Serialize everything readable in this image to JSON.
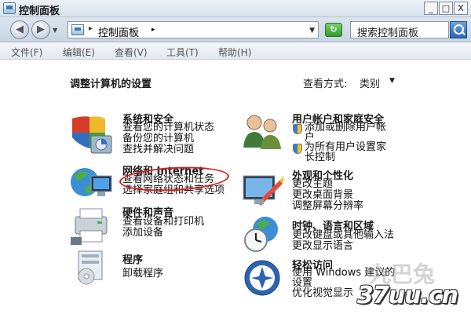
{
  "window": {
    "title": "控制面板",
    "minimize": "_",
    "maximize": "□",
    "close": "X"
  },
  "addressbar": {
    "separator": "▸",
    "path": "控制面板",
    "path_caret": "▸",
    "dropdown": "▼",
    "search_placeholder": "搜索控制面板",
    "back": "◀",
    "forward": "▶",
    "nav_dropdown": "▼",
    "refresh": "↻"
  },
  "menu": [
    "文件(F)",
    "编辑(E)",
    "查看(V)",
    "工具(T)",
    "帮助(H)"
  ],
  "content": {
    "heading": "调整计算机的设置",
    "view_by_label": "查看方式:",
    "view_by_value": "类别",
    "view_by_caret": "▼"
  },
  "categories_left": [
    {
      "title": "系统和安全",
      "links": [
        "查看您的计算机状态",
        "备份您的计算机",
        "查找并解决问题"
      ]
    },
    {
      "title": "网络和 Internet",
      "links": [
        "查看网络状态和任务",
        "选择家庭组和共享选项"
      ]
    },
    {
      "title": "硬件和声音",
      "links": [
        "查看设备和打印机",
        "添加设备"
      ]
    },
    {
      "title": "程序",
      "links": [
        "卸载程序"
      ]
    }
  ],
  "categories_right": [
    {
      "title": "用户帐户和家庭安全",
      "links": [
        "添加或删除用户帐",
        "户",
        "为所有用户设置家",
        "长控制"
      ]
    },
    {
      "title": "外观和个性化",
      "links": [
        "更改主题",
        "更改桌面背景",
        "调整屏幕分辨率"
      ]
    },
    {
      "title": "时钟、语言和区域",
      "links": [
        "更改键盘或其他输入法",
        "更改显示语言"
      ]
    },
    {
      "title": "轻松访问",
      "links": [
        "使用 Windows 建议的",
        "设置",
        "优化视觉显示"
      ]
    }
  ],
  "watermark": {
    "text": "37uu.cn",
    "faint": "九巴兔"
  },
  "colors": {
    "annotation": "#d61f1f",
    "link": "#111111"
  }
}
